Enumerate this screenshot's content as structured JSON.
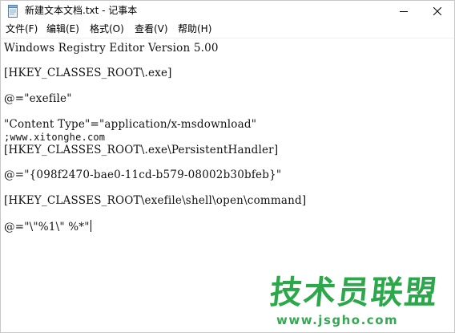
{
  "window": {
    "title": "新建文本文档.txt - 记事本"
  },
  "menu": {
    "items": [
      {
        "label": "文件(F)"
      },
      {
        "label": "编辑(E)"
      },
      {
        "label": "格式(O)"
      },
      {
        "label": "查看(V)"
      },
      {
        "label": "帮助(H)"
      }
    ]
  },
  "editor": {
    "lines": [
      "Windows Registry Editor Version 5.00",
      "[HKEY_CLASSES_ROOT\\.exe]",
      "@=\"exefile\"",
      "\"Content Type\"=\"application/x-msdownload\"",
      ";www.xitonghe.com",
      "[HKEY_CLASSES_ROOT\\.exe\\PersistentHandler]",
      "@=\"{098f2470-bae0-11cd-b579-08002b30bfeb}\"",
      "[HKEY_CLASSES_ROOT\\exefile\\shell\\open\\command]",
      "@=\"\\\"%1\\\" %*\""
    ]
  },
  "watermark": {
    "main": "技术员联盟",
    "url": "www.jsgho.com"
  },
  "icons": {
    "app": "notepad-icon",
    "minimize": "minimize-icon",
    "close": "close-icon"
  },
  "colors": {
    "watermark": "#2aa84a"
  }
}
